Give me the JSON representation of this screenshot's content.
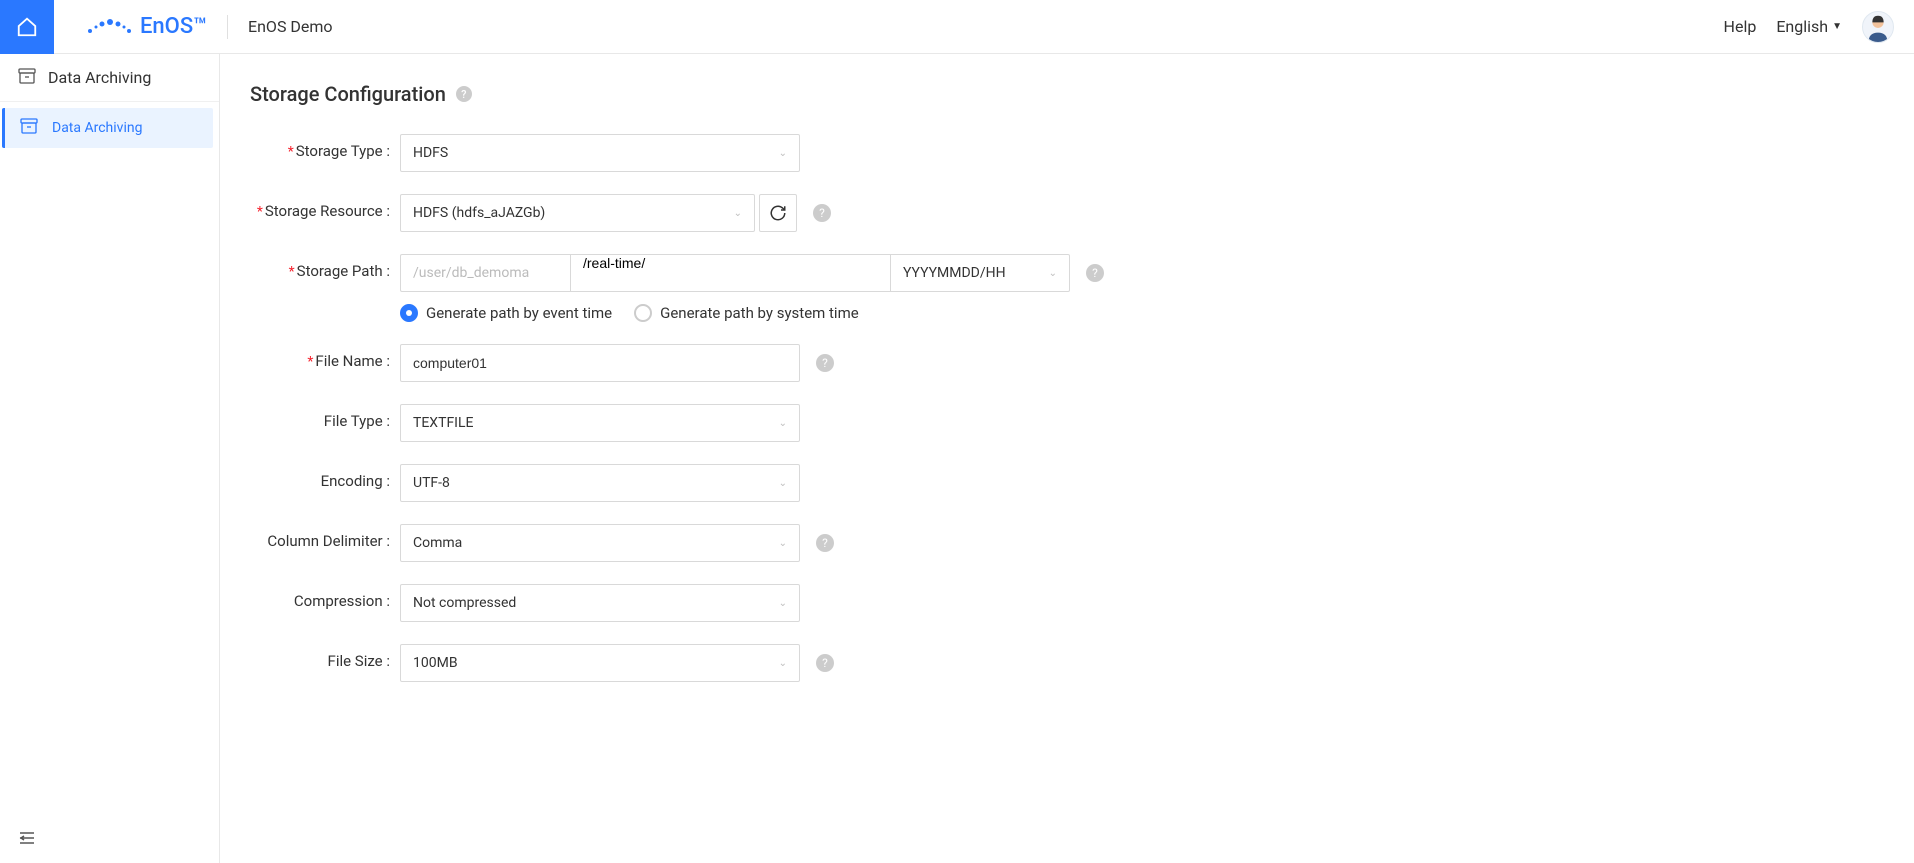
{
  "header": {
    "brand": "EnOS™",
    "demo": "EnOS Demo",
    "help": "Help",
    "language": "English"
  },
  "sidebar": {
    "title": "Data Archiving",
    "items": [
      {
        "label": "Data Archiving"
      }
    ]
  },
  "form": {
    "section_title": "Storage Configuration",
    "storage_type": {
      "label": "Storage Type :",
      "value": "HDFS"
    },
    "storage_resource": {
      "label": "Storage Resource :",
      "value": "HDFS (hdfs_aJAZGb)"
    },
    "storage_path": {
      "label": "Storage Path :",
      "prefix": "/user/db_demoma",
      "value": "/real-time/",
      "pattern": "YYYYMMDD/HH",
      "radio_event": "Generate path by event time",
      "radio_system": "Generate path by system time"
    },
    "file_name": {
      "label": "File Name :",
      "value": "computer01"
    },
    "file_type": {
      "label": "File Type :",
      "value": "TEXTFILE"
    },
    "encoding": {
      "label": "Encoding :",
      "value": "UTF-8"
    },
    "column_delimiter": {
      "label": "Column Delimiter :",
      "value": "Comma"
    },
    "compression": {
      "label": "Compression :",
      "value": "Not compressed"
    },
    "file_size": {
      "label": "File Size :",
      "value": "100MB"
    }
  }
}
